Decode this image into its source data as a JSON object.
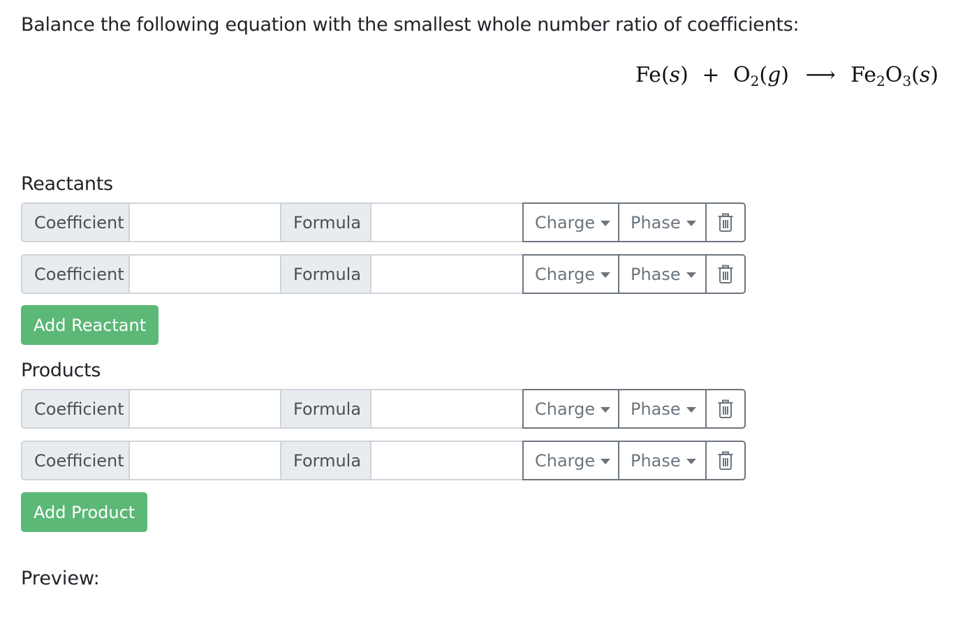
{
  "prompt": "Balance the following equation with the smallest whole number ratio of coefficients:",
  "equation": {
    "r1_species": "Fe",
    "r1_open": "(",
    "r1_phase": "s",
    "r1_close": ")",
    "plus": "+",
    "r2_species": "O",
    "r2_sub": "2",
    "r2_open": "(",
    "r2_phase": "g",
    "r2_close": ")",
    "arrow": "⟶",
    "p1_el1": "Fe",
    "p1_sub1": "2",
    "p1_el2": "O",
    "p1_sub2": "3",
    "p1_open": "(",
    "p1_phase": "s",
    "p1_close": ")"
  },
  "reactants": {
    "title": "Reactants",
    "rows": [
      {
        "coefficient_label": "Coefficient",
        "coefficient_value": "",
        "formula_label": "Formula",
        "formula_value": "",
        "charge_label": "Charge",
        "phase_label": "Phase"
      },
      {
        "coefficient_label": "Coefficient",
        "coefficient_value": "",
        "formula_label": "Formula",
        "formula_value": "",
        "charge_label": "Charge",
        "phase_label": "Phase"
      }
    ],
    "add_label": "Add Reactant"
  },
  "products": {
    "title": "Products",
    "rows": [
      {
        "coefficient_label": "Coefficient",
        "coefficient_value": "",
        "formula_label": "Formula",
        "formula_value": "",
        "charge_label": "Charge",
        "phase_label": "Phase"
      },
      {
        "coefficient_label": "Coefficient",
        "coefficient_value": "",
        "formula_label": "Formula",
        "formula_value": "",
        "charge_label": "Charge",
        "phase_label": "Phase"
      }
    ],
    "add_label": "Add Product"
  },
  "preview_label": "Preview:",
  "icons": {
    "delete": "trash-icon",
    "dropdown": "caret-down-icon"
  },
  "colors": {
    "add_button": "#5cb877",
    "addon_bg": "#e9ecef",
    "dropdown_border": "#6c757d"
  }
}
